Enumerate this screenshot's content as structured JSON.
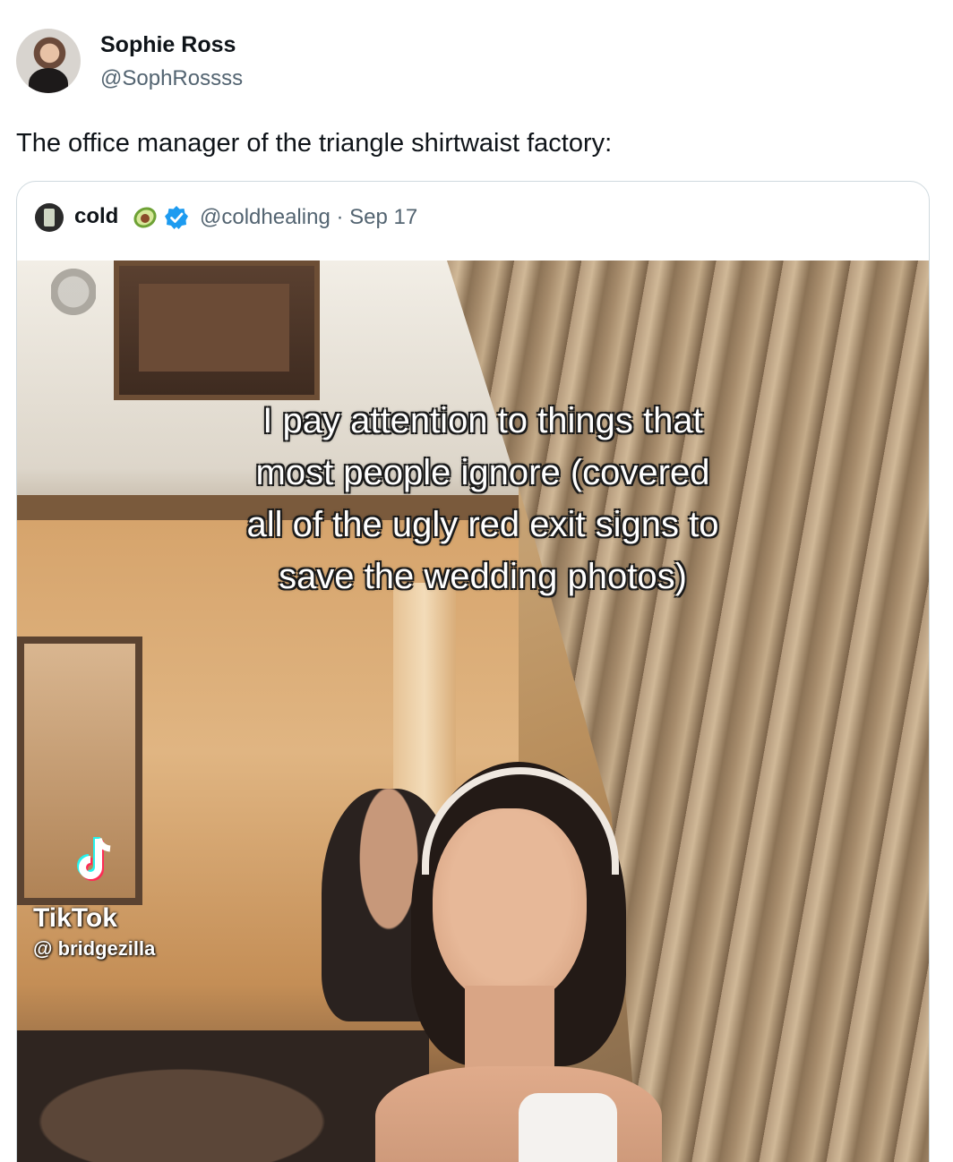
{
  "tweet": {
    "author_name": "Sophie Ross",
    "author_handle": "@SophRossss",
    "text": "The office manager of the triangle shirtwaist factory:"
  },
  "quoted_tweet": {
    "author_name": "cold",
    "author_emoji": "avocado-icon",
    "verified": true,
    "handle": "@coldhealing",
    "separator": "·",
    "date": "Sep 17",
    "meta": "@coldhealing · Sep 17",
    "media": {
      "overlay_caption": "I pay attention to things that\nmost people ignore (covered\nall of the ugly red exit signs to\nsave the wedding photos)",
      "watermark_brand": "TikTok",
      "watermark_user": "@ bridgezilla"
    }
  },
  "colors": {
    "text_primary": "#0f1419",
    "text_secondary": "#536471",
    "verified_blue": "#1d9bf0",
    "card_border": "#cfd9de"
  }
}
